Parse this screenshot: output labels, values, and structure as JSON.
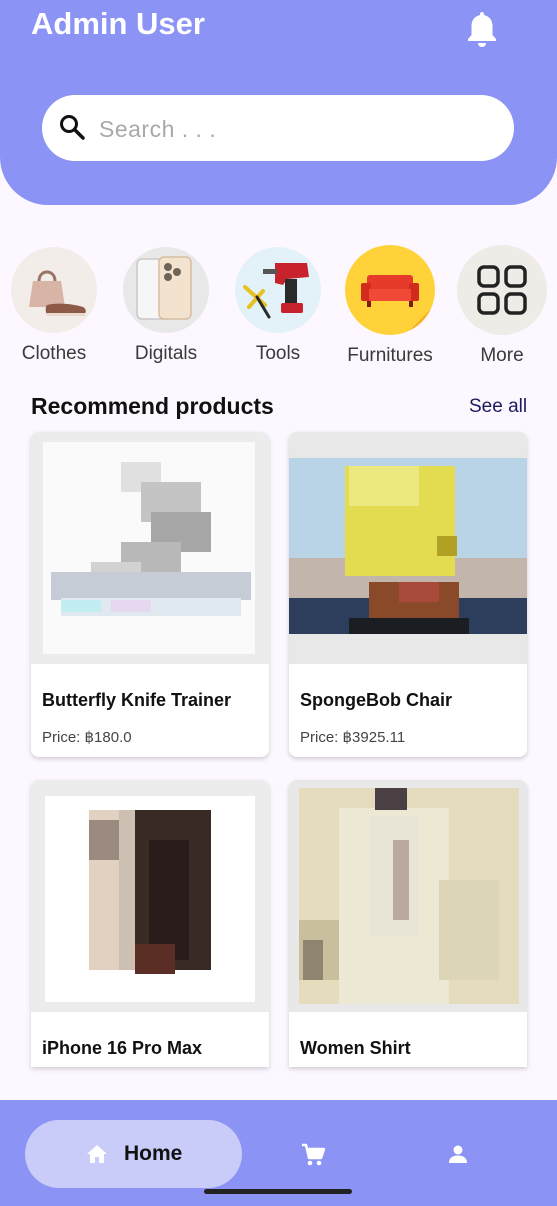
{
  "header": {
    "title": "Admin User",
    "notification_icon": "bell-icon",
    "background_color": "#8b93f4"
  },
  "search": {
    "placeholder": "Search . . .",
    "icon": "search-icon"
  },
  "categories": [
    {
      "label": "Clothes",
      "icon": "clothes-icon"
    },
    {
      "label": "Digitals",
      "icon": "phone-icon"
    },
    {
      "label": "Tools",
      "icon": "drill-icon"
    },
    {
      "label": "Furnitures",
      "icon": "sofa-icon"
    },
    {
      "label": "More",
      "icon": "grid-icon"
    }
  ],
  "recommend": {
    "title": "Recommend products",
    "see_all": "See all",
    "products": [
      {
        "name": "Butterfly Knife Trainer",
        "price": "Price: ฿180.0"
      },
      {
        "name": "SpongeBob Chair",
        "price": "Price: ฿3925.11"
      },
      {
        "name": "iPhone 16 Pro Max",
        "price": ""
      },
      {
        "name": "Women Shirt",
        "price": ""
      }
    ]
  },
  "bottom_nav": {
    "home_label": "Home",
    "home_icon": "home-icon",
    "cart_icon": "cart-icon",
    "profile_icon": "person-icon",
    "active_color": "#c9ccf9"
  }
}
